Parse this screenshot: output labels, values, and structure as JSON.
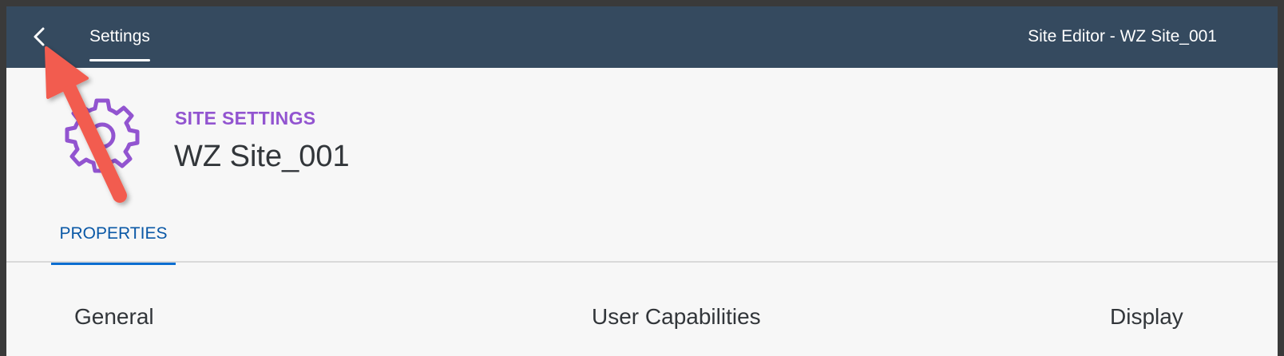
{
  "shell": {
    "back_icon": "chevron-left-icon",
    "settings_tab_label": "Settings",
    "title": "Site Editor - WZ Site_001",
    "bar_color": "#354a5f"
  },
  "object_header": {
    "icon": "gear-icon",
    "subtitle": "SITE SETTINGS",
    "title": "WZ Site_001",
    "accent_color": "#9254d0"
  },
  "tabs": [
    {
      "label": "PROPERTIES",
      "selected": true
    }
  ],
  "sections": {
    "general": "General",
    "user_capabilities": "User Capabilities",
    "display": "Display"
  },
  "annotation": {
    "type": "red-arrow",
    "points_to": "back-button",
    "color": "#f25c4f"
  }
}
